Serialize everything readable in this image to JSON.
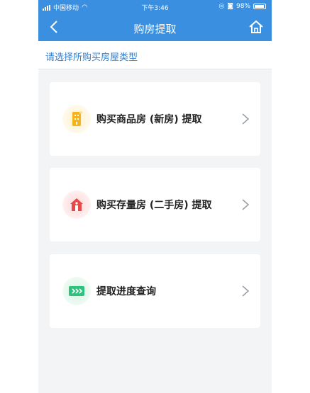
{
  "status_bar": {
    "carrier": "中国移动",
    "time": "下午3:46",
    "battery": "98%"
  },
  "nav": {
    "title": "购房提取",
    "back_icon": "chevron-left-icon",
    "home_icon": "home-icon"
  },
  "subtitle": "请选择所购买房屋类型",
  "options": [
    {
      "label": "购买商品房 (新房) 提取",
      "icon": "building-icon",
      "accent": "#f5b31c"
    },
    {
      "label": "购买存量房 (二手房) 提取",
      "icon": "house-icon",
      "accent": "#e8484a"
    },
    {
      "label": "提取进度查询",
      "icon": "progress-arrows-icon",
      "accent": "#2ec27e"
    }
  ],
  "colors": {
    "header": "#3a8fe0",
    "subtitle": "#2f7fd1",
    "background": "#f3f4f6"
  }
}
